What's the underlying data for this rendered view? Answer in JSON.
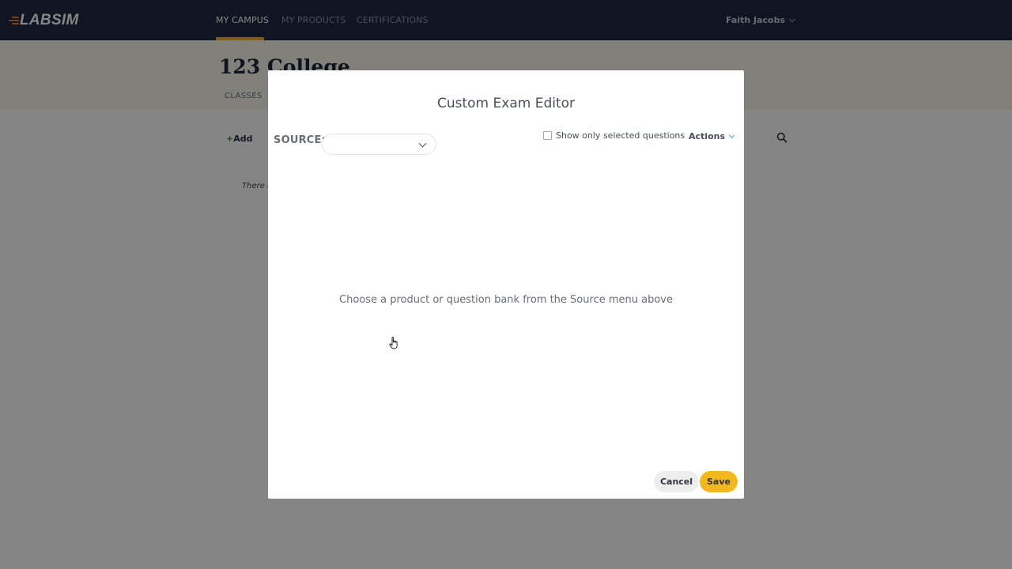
{
  "app": {
    "logo_text": "LABSIM"
  },
  "nav": {
    "items": [
      {
        "label": "MY CAMPUS",
        "active": true
      },
      {
        "label": "MY PRODUCTS",
        "active": false
      },
      {
        "label": "CERTIFICATIONS",
        "active": false
      }
    ],
    "user_name": "Faith Jacobs"
  },
  "page": {
    "title": "123 College",
    "tabs": [
      "CLASSES"
    ],
    "add_label": "Add",
    "empty_note": "There d"
  },
  "modal": {
    "title": "Custom Exam Editor",
    "source_label": "SOURCE:",
    "source_value": "",
    "show_only_label": "Show only selected questions",
    "show_only_checked": false,
    "actions_label": "Actions",
    "empty_message": "Choose a product or question bank from the Source menu above",
    "cancel_label": "Cancel",
    "save_label": "Save"
  },
  "colors": {
    "nav_bg": "#1f2a44",
    "accent": "#f5b81c",
    "logo_accent": "#f07f2a",
    "link_accent": "#34a7c9"
  }
}
